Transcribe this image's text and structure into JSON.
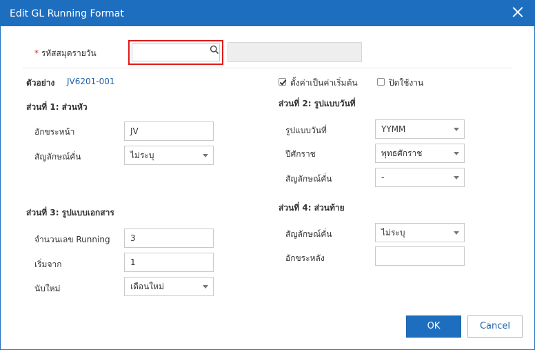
{
  "dialog": {
    "title": "Edit GL Running Format",
    "close_icon": "close-icon"
  },
  "journal_code": {
    "required_mark": "*",
    "label": "รหัสสมุดรายวัน",
    "value": "",
    "name_value": "",
    "search_icon": "search-icon"
  },
  "example": {
    "label": "ตัวอย่าง",
    "value": "JV6201-001"
  },
  "options": {
    "set_default_label": "ตั้งค่าเป็นค่าเริ่มต้น",
    "set_default_checked": true,
    "disable_label": "ปิดใช้งาน",
    "disable_checked": false
  },
  "part1": {
    "heading": "ส่วนที่ 1: ส่วนหัว",
    "prefix_label": "อักขระหน้า",
    "prefix_value": "JV",
    "separator_label": "สัญลักษณ์คั่น",
    "separator_value": "ไม่ระบุ"
  },
  "part2": {
    "heading": "ส่วนที่ 2: รูปแบบวันที่",
    "date_format_label": "รูปแบบวันที่",
    "date_format_value": "YYMM",
    "era_label": "ปีศักราช",
    "era_value": "พุทธศักราช",
    "separator_label": "สัญลักษณ์คั่น",
    "separator_value": "-"
  },
  "part3": {
    "heading": "ส่วนที่ 3: รูปแบบเอกสาร",
    "running_digits_label": "จำนวนเลข Running",
    "running_digits_value": "3",
    "start_label": "เริ่มจาก",
    "start_value": "1",
    "reset_label": "นับใหม่",
    "reset_value": "เดือนใหม่"
  },
  "part4": {
    "heading": "ส่วนที่ 4: ส่วนท้าย",
    "separator_label": "สัญลักษณ์คั่น",
    "separator_value": "ไม่ระบุ",
    "suffix_label": "อักขระหลัง",
    "suffix_value": ""
  },
  "buttons": {
    "ok": "OK",
    "cancel": "Cancel"
  },
  "colors": {
    "titlebar": "#1e6ec0",
    "highlight_border": "#e01818",
    "link": "#1f5fa8"
  }
}
